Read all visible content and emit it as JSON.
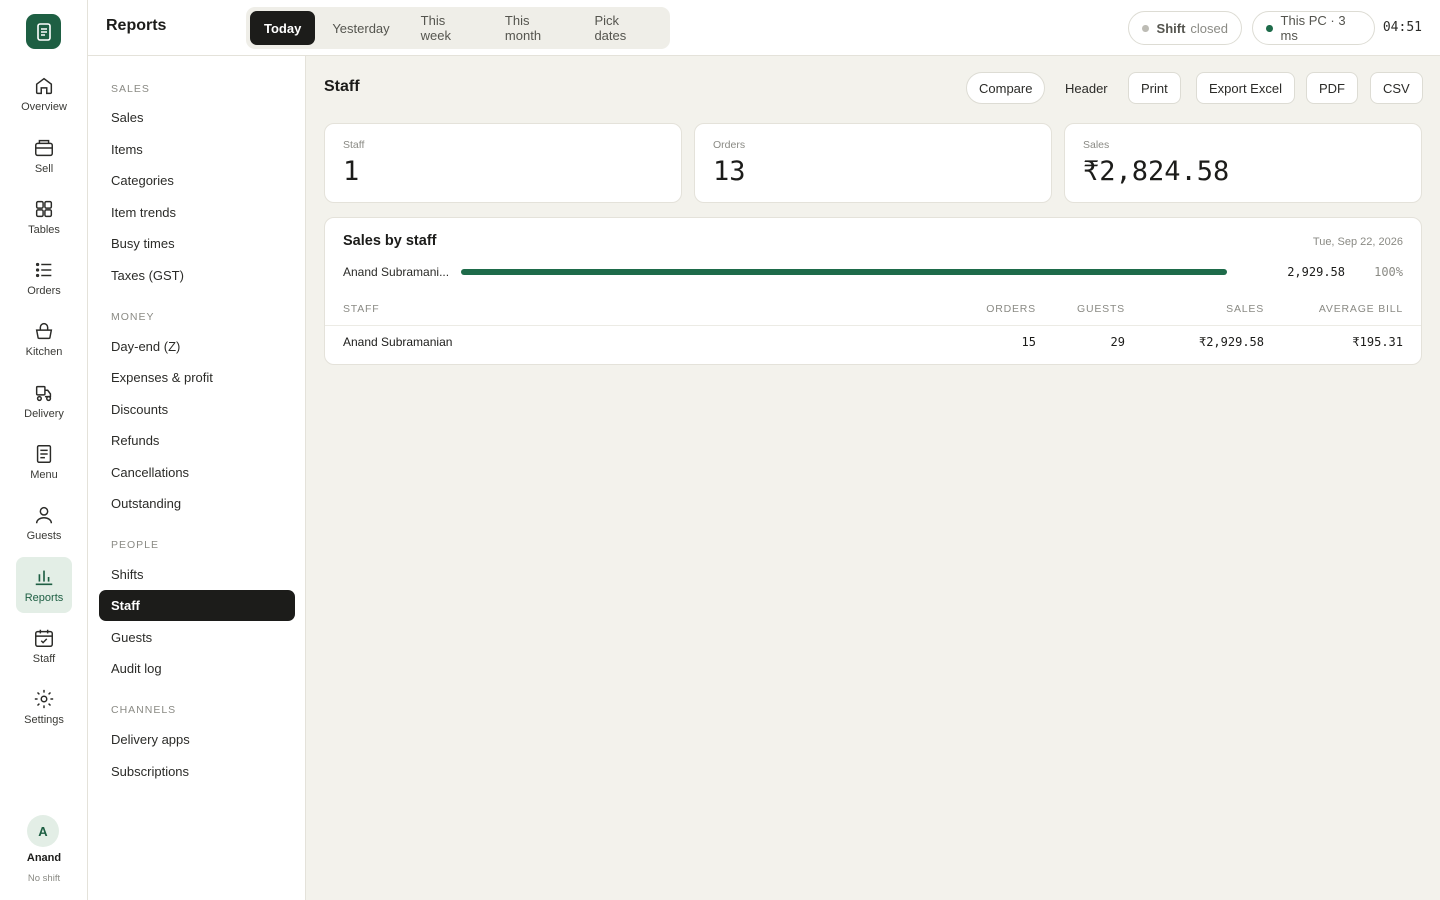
{
  "app": {
    "section_title": "Reports"
  },
  "colors": {
    "brand": "#1e5f43",
    "bar": "#1e6b4a",
    "active": "#1c1c1a"
  },
  "rail": {
    "items": [
      {
        "label": "Overview",
        "icon": "home-icon"
      },
      {
        "label": "Sell",
        "icon": "register-icon"
      },
      {
        "label": "Tables",
        "icon": "grid-icon"
      },
      {
        "label": "Orders",
        "icon": "list-icon"
      },
      {
        "label": "Kitchen",
        "icon": "basket-icon"
      },
      {
        "label": "Delivery",
        "icon": "scooter-icon"
      },
      {
        "label": "Menu",
        "icon": "document-icon"
      },
      {
        "label": "Guests",
        "icon": "person-icon"
      },
      {
        "label": "Reports",
        "icon": "bar-chart-icon",
        "active": true
      },
      {
        "label": "Staff",
        "icon": "calendar-check-icon"
      },
      {
        "label": "Settings",
        "icon": "gear-icon"
      }
    ],
    "user": {
      "initial": "A",
      "name": "Anand",
      "status": "No shift"
    }
  },
  "topbar": {
    "ranges": [
      "Today",
      "Yesterday",
      "This week",
      "This month",
      "Pick dates"
    ],
    "active_range": "Today",
    "shift": {
      "label": "Shift",
      "state": "closed"
    },
    "device": "This PC · 3 ms",
    "clock": "04:51"
  },
  "subnav": {
    "sections": [
      {
        "title": "SALES",
        "items": [
          "Sales",
          "Items",
          "Categories",
          "Item trends",
          "Busy times",
          "Taxes (GST)"
        ]
      },
      {
        "title": "MONEY",
        "items": [
          "Day-end (Z)",
          "Expenses & profit",
          "Discounts",
          "Refunds",
          "Cancellations",
          "Outstanding"
        ]
      },
      {
        "title": "PEOPLE",
        "items": [
          "Shifts",
          "Staff",
          "Guests",
          "Audit log"
        ]
      },
      {
        "title": "CHANNELS",
        "items": [
          "Delivery apps",
          "Subscriptions"
        ]
      }
    ],
    "active": "Staff"
  },
  "main": {
    "title": "Staff",
    "actions": {
      "compare": "Compare",
      "header": "Header",
      "print": "Print",
      "export_excel": "Export Excel",
      "pdf": "PDF",
      "csv": "CSV"
    },
    "kpis": [
      {
        "label": "Staff",
        "value": "1"
      },
      {
        "label": "Orders",
        "value": "13"
      },
      {
        "label": "Sales",
        "value": "₹2,824.58"
      }
    ],
    "sales_by_staff": {
      "title": "Sales by staff",
      "date": "Tue, Sep 22, 2026",
      "bars": [
        {
          "name": "Anand Subramani...",
          "value_label": "2,929.58",
          "pct_label": "100%",
          "share": 1.0
        }
      ],
      "columns": [
        "STAFF",
        "ORDERS",
        "GUESTS",
        "SALES",
        "AVERAGE BILL"
      ],
      "rows": [
        {
          "staff": "Anand Subramanian",
          "orders": "15",
          "guests": "29",
          "sales": "₹2,929.58",
          "avg_bill": "₹195.31"
        }
      ]
    }
  }
}
